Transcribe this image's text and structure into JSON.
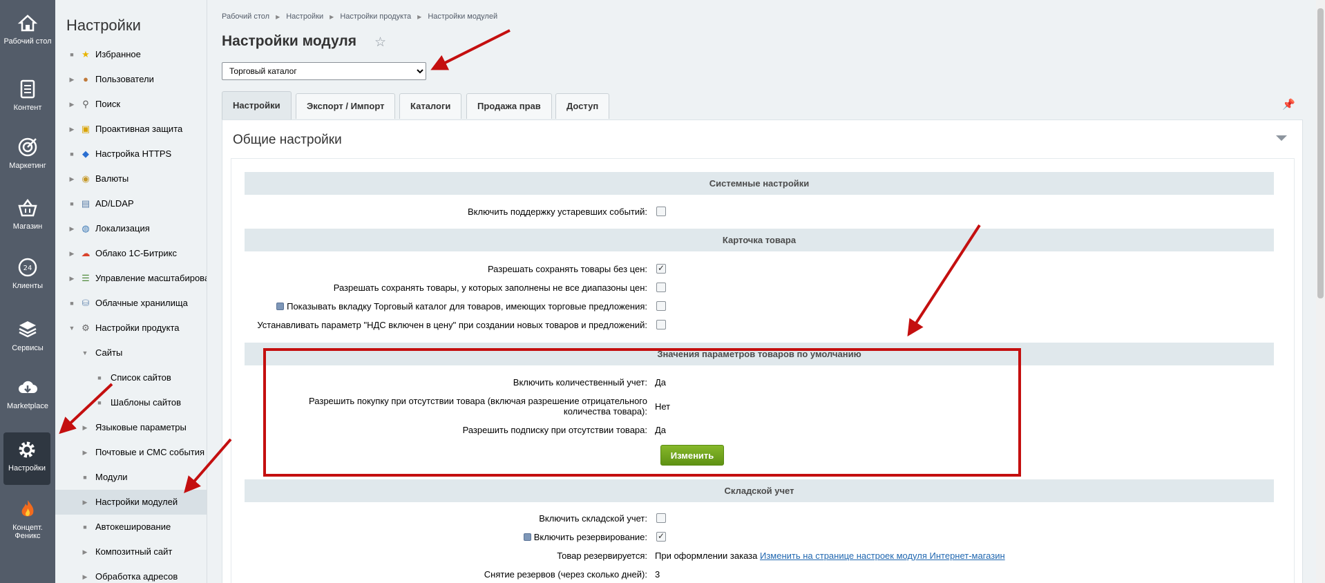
{
  "rail": {
    "items": [
      {
        "label": "Рабочий стол",
        "icon": "home-icon"
      },
      {
        "label": "Контент",
        "icon": "document-icon"
      },
      {
        "label": "Маркетинг",
        "icon": "target-icon"
      },
      {
        "label": "Магазин",
        "icon": "basket-icon"
      },
      {
        "label": "Клиенты",
        "icon": "clock-24-icon"
      },
      {
        "label": "Сервисы",
        "icon": "layers-icon"
      },
      {
        "label": "Marketplace",
        "icon": "cloud-download-icon"
      },
      {
        "label": "Настройки",
        "icon": "gear-icon",
        "active": true
      },
      {
        "label": "Концепт. Феникс",
        "icon": "fire-icon"
      }
    ]
  },
  "menu": {
    "title": "Настройки",
    "items": [
      {
        "label": "Избранное",
        "icon": "star-icon"
      },
      {
        "label": "Пользователи",
        "icon": "user-icon"
      },
      {
        "label": "Поиск",
        "icon": "magnifier-icon"
      },
      {
        "label": "Проактивная защита",
        "icon": "lock-icon"
      },
      {
        "label": "Настройка HTTPS",
        "icon": "shield-icon"
      },
      {
        "label": "Валюты",
        "icon": "coin-icon"
      },
      {
        "label": "AD/LDAP",
        "icon": "directory-icon"
      },
      {
        "label": "Локализация",
        "icon": "globe-icon"
      },
      {
        "label": "Облако 1С-Битрикс",
        "icon": "cloud-icon"
      },
      {
        "label": "Управление масштабирова",
        "icon": "servers-icon"
      },
      {
        "label": "Облачные хранилища",
        "icon": "storage-icon"
      },
      {
        "label": "Настройки продукта",
        "icon": "gear-icon"
      },
      {
        "label": "Сайты"
      },
      {
        "label": "Список сайтов"
      },
      {
        "label": "Шаблоны сайтов"
      },
      {
        "label": "Языковые параметры"
      },
      {
        "label": "Почтовые и СМС события"
      },
      {
        "label": "Модули"
      },
      {
        "label": "Настройки модулей"
      },
      {
        "label": "Автокеширование"
      },
      {
        "label": "Композитный сайт"
      },
      {
        "label": "Обработка адресов"
      }
    ]
  },
  "breadcrumb": [
    "Рабочий стол",
    "Настройки",
    "Настройки продукта",
    "Настройки модулей"
  ],
  "page": {
    "title": "Настройки модуля",
    "module_select": {
      "value": "Торговый каталог",
      "options": [
        "Торговый каталог"
      ]
    }
  },
  "tabs": [
    "Настройки",
    "Экспорт / Импорт",
    "Каталоги",
    "Продажа прав",
    "Доступ"
  ],
  "panel": {
    "title": "Общие настройки",
    "sections": {
      "system": "Системные настройки",
      "card": "Карточка товара",
      "defaults": "Значения параметров товаров по умолчанию",
      "stock": "Складской учет"
    },
    "rows": {
      "old_events": "Включить поддержку устаревших событий:",
      "save_no_price": "Разрешать сохранять товары без цен:",
      "save_partial_ranges": "Разрешать сохранять товары, у которых заполнены не все диапазоны цен:",
      "show_catalog_tab": "Показывать вкладку Торговый каталог для товаров, имеющих торговые предложения:",
      "vat_included": "Устанавливать параметр \"НДС включен в цену\" при создании новых товаров и предложений:",
      "quantity_trace": "Включить количественный учет:",
      "quantity_trace_value": "Да",
      "can_buy_zero": "Разрешить покупку при отсутствии товара (включая разрешение отрицательного количества товара):",
      "can_buy_zero_value": "Нет",
      "subscribe": "Разрешить подписку при отсутствии товара:",
      "subscribe_value": "Да",
      "edit_button": "Изменить",
      "store_control": "Включить складской учет:",
      "reservation": "Включить резервирование:",
      "reserved_when": "Товар резервируется:",
      "reserved_when_value": "При оформлении заказа",
      "reserved_when_link": "Изменить на странице настроек модуля Интернет-магазин",
      "reserve_release": "Снятие резервов (через сколько дней):",
      "reserve_release_value": "3"
    }
  },
  "colors": {
    "accent_green": "#6fa31c",
    "annotation_red": "#c40f0f",
    "rail_bg": "#535c69"
  }
}
